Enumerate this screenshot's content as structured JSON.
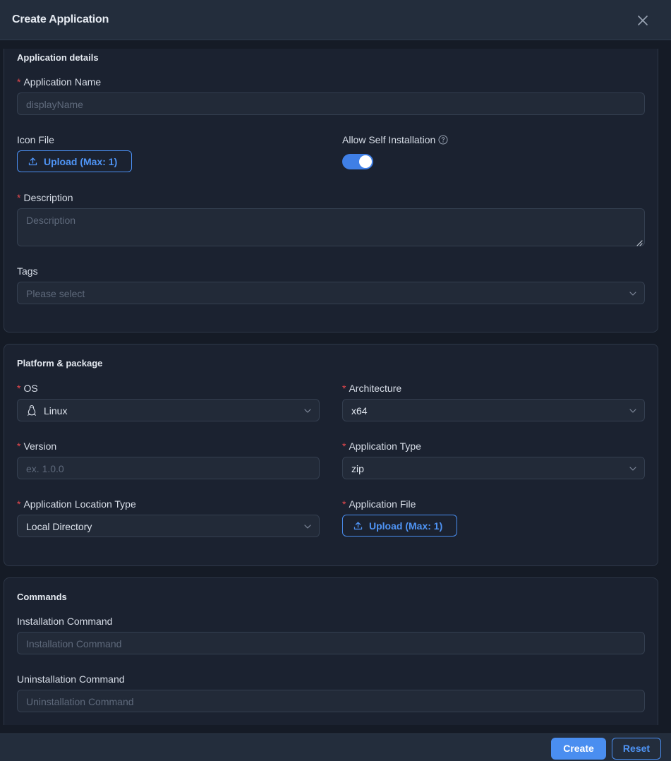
{
  "dialog": {
    "title": "Create Application"
  },
  "details": {
    "section_title": "Application details",
    "app_name_label": "Application Name",
    "app_name_placeholder": "displayName",
    "icon_file_label": "Icon File",
    "upload_label": "Upload (Max: 1)",
    "self_install_label": "Allow Self Installation",
    "self_install_enabled": true,
    "description_label": "Description",
    "description_placeholder": "Description",
    "tags_label": "Tags",
    "tags_placeholder": "Please select"
  },
  "platform": {
    "section_title": "Platform & package",
    "os_label": "OS",
    "os_value": "Linux",
    "arch_label": "Architecture",
    "arch_value": "x64",
    "version_label": "Version",
    "version_placeholder": "ex. 1.0.0",
    "app_type_label": "Application Type",
    "app_type_value": "zip",
    "location_type_label": "Application Location Type",
    "location_type_value": "Local Directory",
    "app_file_label": "Application File",
    "upload_label": "Upload (Max: 1)"
  },
  "commands": {
    "section_title": "Commands",
    "install_label": "Installation Command",
    "install_placeholder": "Installation Command",
    "uninstall_label": "Uninstallation Command",
    "uninstall_placeholder": "Uninstallation Command"
  },
  "footer": {
    "create_label": "Create",
    "reset_label": "Reset"
  },
  "icons": {
    "close": "close-icon",
    "upload": "upload-icon",
    "help": "question-circle-icon",
    "chevron": "chevron-down-icon",
    "os": "linux-penguin-icon"
  },
  "colors": {
    "accent": "#4a8ef0",
    "required": "#e5484d",
    "background": "#151b26"
  }
}
